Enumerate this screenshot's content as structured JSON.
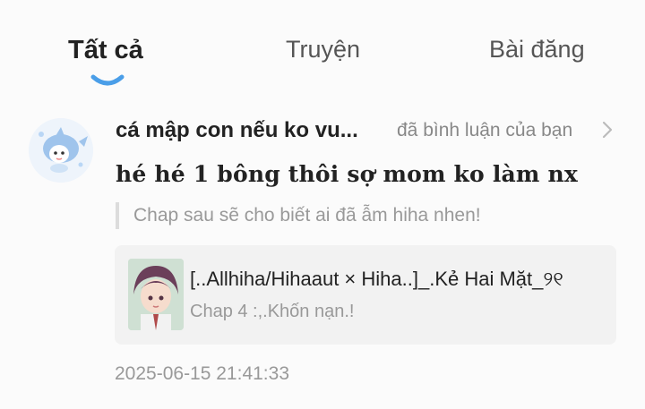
{
  "tabs": [
    {
      "label": "Tất cả",
      "active": true
    },
    {
      "label": "Truyện",
      "active": false
    },
    {
      "label": "Bài đăng",
      "active": false
    }
  ],
  "colors": {
    "accent": "#4a9ee8",
    "text": "#222222",
    "muted": "#999999",
    "card_bg": "#f2f2f2"
  },
  "notification": {
    "username": "cá mập con nếu ko vu...",
    "action": "đã bình luận của bạn",
    "comment": "hé hé 1 bông thôi sợ mom ko làm nx",
    "quoted_reply": "Chap sau sẽ cho biết ai đã ẫm hiha nhen!",
    "story": {
      "title": "[..Allhiha/Hihaaut × Hiha..]_.Kẻ Hai Mặt_୨୧",
      "chapter": "Chap 4 :,.Khốn nạn.!"
    },
    "timestamp": "2025-06-15 21:41:33"
  },
  "icons": {
    "chevron": "chevron-right-icon",
    "tab_indicator": "smile-underline"
  }
}
